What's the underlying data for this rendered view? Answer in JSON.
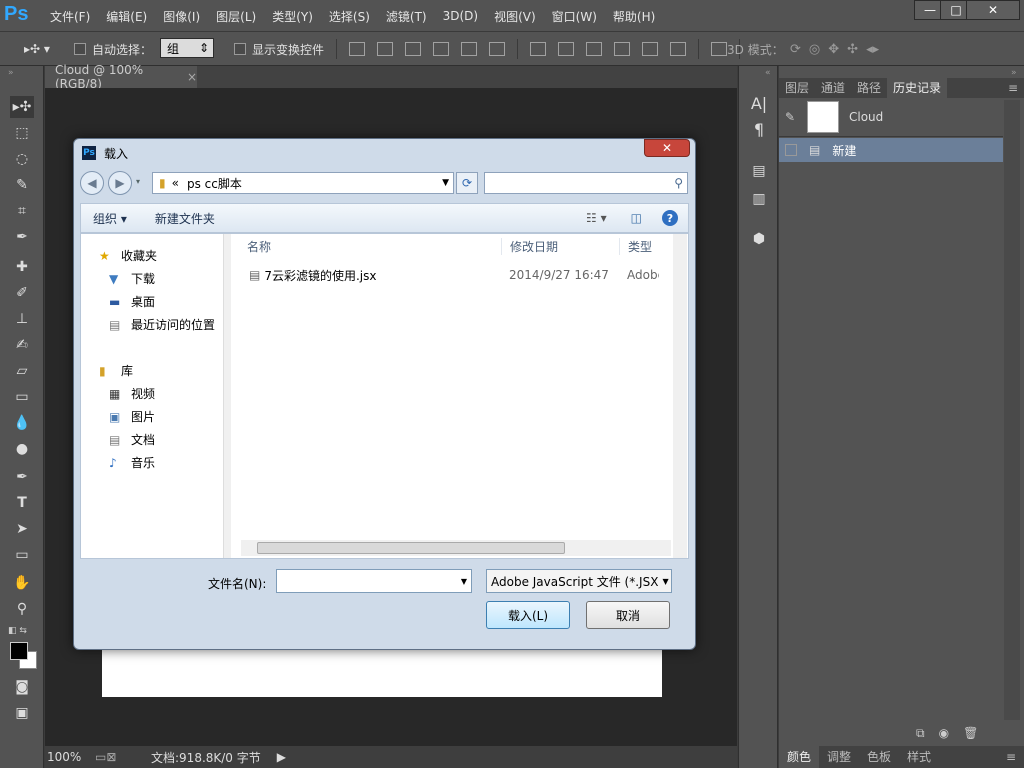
{
  "app": {
    "logo": "Ps",
    "menu": [
      "文件(F)",
      "编辑(E)",
      "图像(I)",
      "图层(L)",
      "类型(Y)",
      "选择(S)",
      "滤镜(T)",
      "3D(D)",
      "视图(V)",
      "窗口(W)",
      "帮助(H)"
    ],
    "window_controls": {
      "minimize": "—",
      "maximize": "□",
      "close": "✕"
    }
  },
  "options": {
    "auto_select_label": "自动选择：",
    "auto_select_value": "组",
    "show_transform_label": "显示变换控件",
    "mode_label": "3D 模式："
  },
  "document": {
    "tab_label": "Cloud @ 100%(RGB/8)",
    "tab_close": "×",
    "zoom": "100%",
    "doc_info": "文档:918.8K/0 字节"
  },
  "panels": {
    "tabs": [
      "图层",
      "通道",
      "路径",
      "历史记录"
    ],
    "active_tab": "历史记录",
    "snapshot_name": "Cloud",
    "history_item": "新建",
    "bottom_tabs": [
      "颜色",
      "调整",
      "色板",
      "样式"
    ],
    "bottom_active": "颜色"
  },
  "dialog": {
    "title": "载入",
    "close_symbol": "✕",
    "address": "ps cc脚本",
    "address_prefix": "«",
    "organize": "组织 ▾",
    "new_folder": "新建文件夹",
    "nav": {
      "favorites": "收藏夹",
      "downloads": "下载",
      "desktop": "桌面",
      "recent": "最近访问的位置",
      "library": "库",
      "videos": "视频",
      "pictures": "图片",
      "documents": "文档",
      "music": "音乐"
    },
    "columns": {
      "name": "名称",
      "date": "修改日期",
      "type": "类型"
    },
    "files": [
      {
        "name": "7云彩滤镜的使用.jsx",
        "date": "2014/9/27 16:47",
        "type": "Adobe"
      }
    ],
    "filename_label": "文件名(N):",
    "filename_value": "",
    "filetype": "Adobe JavaScript 文件 (*.JSX",
    "load_button": "载入(L)",
    "cancel_button": "取消"
  }
}
